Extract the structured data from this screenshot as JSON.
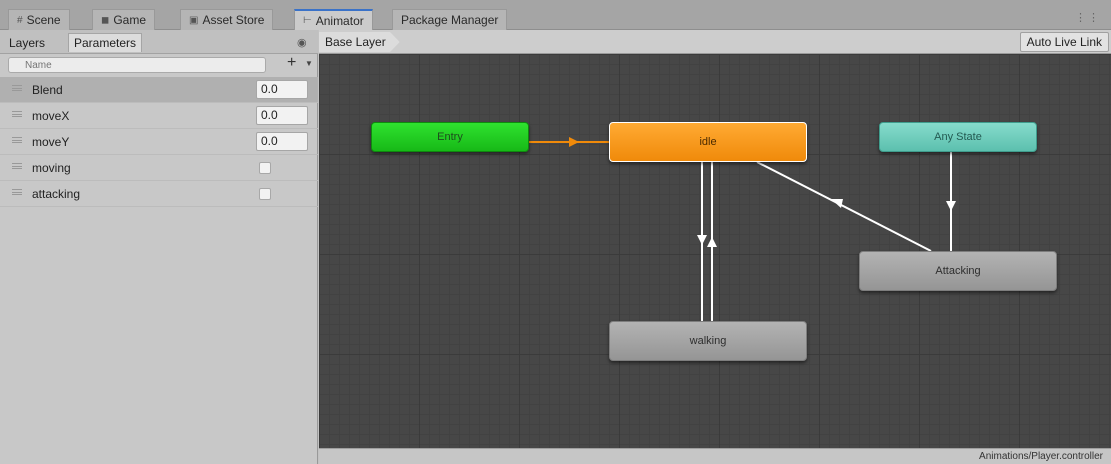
{
  "tabs": [
    {
      "label": "Scene",
      "icon": "scene-icon"
    },
    {
      "label": "Game",
      "icon": "game-icon"
    },
    {
      "label": "Asset Store",
      "icon": "store-icon"
    },
    {
      "label": "Animator",
      "icon": "animator-icon"
    },
    {
      "label": "Package Manager",
      "icon": ""
    }
  ],
  "active_tab": "Animator",
  "left_panel": {
    "subtabs": [
      "Layers",
      "Parameters"
    ],
    "active_subtab": "Parameters",
    "search_placeholder": "Name",
    "parameters": [
      {
        "name": "Blend",
        "value": "0.0",
        "type": "float",
        "selected": true
      },
      {
        "name": "moveX",
        "value": "0.0",
        "type": "float",
        "selected": false
      },
      {
        "name": "moveY",
        "value": "0.0",
        "type": "float",
        "selected": false
      },
      {
        "name": "moving",
        "value": false,
        "type": "bool",
        "selected": false
      },
      {
        "name": "attacking",
        "value": false,
        "type": "bool",
        "selected": false
      }
    ]
  },
  "graph": {
    "breadcrumb": "Base Layer",
    "live_link_label": "Auto Live Link",
    "states": {
      "entry": "Entry",
      "idle": "idle",
      "any_state": "Any State",
      "attacking": "Attacking",
      "walking": "walking"
    },
    "default_transition_color": "#f08a0a",
    "transition_color": "#ffffff",
    "footer_path": "Animations/Player.controller"
  },
  "colors": {
    "entry": "#22cc22",
    "idle": "#f59a1c",
    "any_state": "#6fcebd",
    "state": "#a5a5a5",
    "accent": "#3a72c8"
  }
}
